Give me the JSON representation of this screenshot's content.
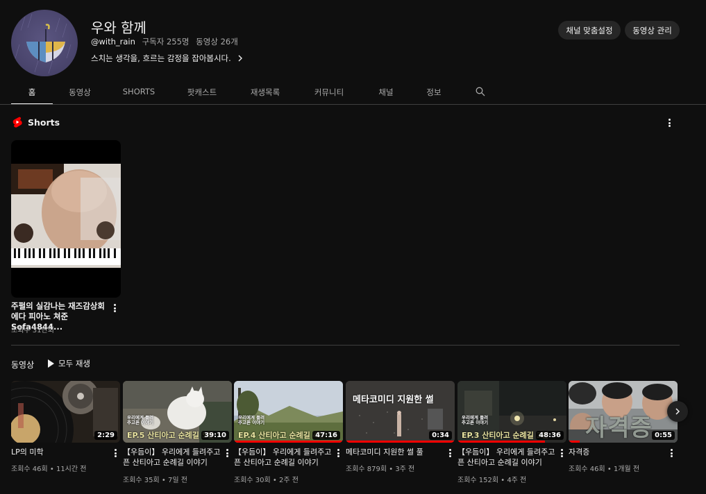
{
  "channel": {
    "name": "우와 함께",
    "handle": "@with_rain",
    "subscribers": "구독자 255명",
    "video_count": "동영상 26개",
    "description": "스치는 생각을, 흐르는 감정을 잡아봅시다.",
    "buttons": {
      "customize": "채널 맞춤설정",
      "manage": "동영상 관리"
    }
  },
  "tabs": [
    "홈",
    "동영상",
    "SHORTS",
    "팟캐스트",
    "재생목록",
    "커뮤니티",
    "채널",
    "정보"
  ],
  "shorts": {
    "section_title": "Shorts",
    "items": [
      {
        "title": "주펄의 실감나는 재즈감상회 에다 피아노 쳐준 Sofa4844...",
        "views": "조회수 31만회"
      }
    ]
  },
  "videos": {
    "section_title": "동영상",
    "play_all": "모두 재생",
    "items": [
      {
        "title": "LP의 미학",
        "meta": "조회수 46회 • 11시간 전",
        "duration": "2:29",
        "progress": 0
      },
      {
        "title": "【우듬이】 우리에게 들려주고픈 산티아고 순례길 이야기 5...",
        "meta": "조회수 35회 • 7일 전",
        "duration": "39:10",
        "overlay": "EP.5 산티아고 순례길 5편",
        "overlay_small": "우리에게 들려주고픈 이야기",
        "progress": 0
      },
      {
        "title": "【우듬이】 우리에게 들려주고픈 산티아고 순례길 이야기 4...",
        "meta": "조회수 30회 • 2주 전",
        "duration": "47:16",
        "overlay": "EP.4 산티아고 순례길 4편",
        "overlay_small": "우리에게 들려주고픈 이야기",
        "progress": 1
      },
      {
        "title": "메타코미디 지원한 썰 풀",
        "meta": "조회수 879회 • 3주 전",
        "duration": "0:34",
        "overlay": "메타코미디 지원한 썰",
        "progress": 1
      },
      {
        "title": "【우듬이】 우리에게 들려주고픈 산티아고 순례길 이야기 3...",
        "meta": "조회수 152회 • 4주 전",
        "duration": "48:36",
        "overlay": "EP.3 산티아고 순례길 3편",
        "overlay_small": "우리에게 들려주고픈 이야기",
        "progress": 0.8
      },
      {
        "title": "자격증",
        "meta": "조회수 46회 • 1개월 전",
        "duration": "0:55",
        "overlay": "자격증",
        "progress": 0.1
      }
    ]
  },
  "colors": {
    "background": "#0f0f0f",
    "accent": "#ff0000",
    "text": "#f1f1f1",
    "muted": "#aaaaaa"
  }
}
